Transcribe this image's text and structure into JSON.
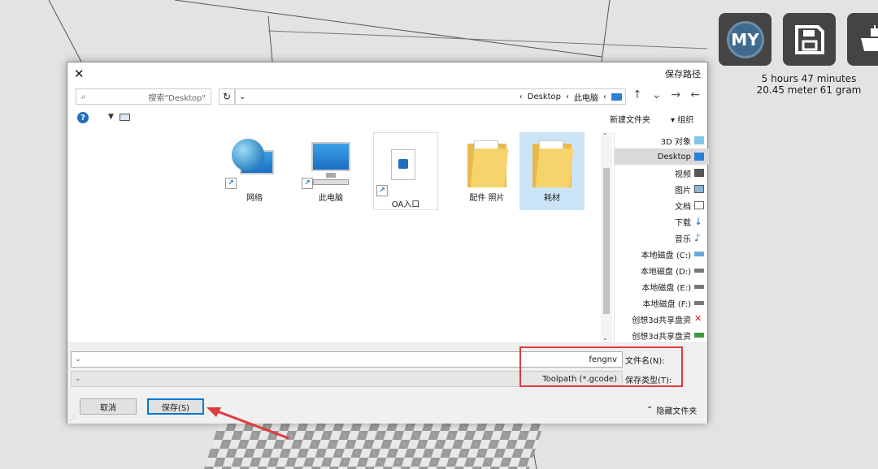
{
  "scene": {
    "buttons": [
      {
        "name": "my-icon",
        "label": "MY"
      },
      {
        "name": "save-icon"
      },
      {
        "name": "ship-icon"
      }
    ],
    "print_time": "5 hours 47 minutes",
    "print_material": "20.45 meter 61 gram"
  },
  "dialog": {
    "title": "保存路径",
    "close_glyph": "✕",
    "search_placeholder": "搜索\"Desktop\"",
    "refresh_glyph": "↻",
    "breadcrumbs": [
      "Desktop",
      "此电脑"
    ],
    "toolbar": {
      "organize": "组织",
      "new_folder": "新建文件夹"
    },
    "nav_items": [
      {
        "label": "3D 对象"
      },
      {
        "label": "Desktop",
        "selected": true
      },
      {
        "label": "视频"
      },
      {
        "label": "图片"
      },
      {
        "label": "文档"
      },
      {
        "label": "下载"
      },
      {
        "label": "音乐"
      },
      {
        "label": "本地磁盘 (C:)"
      },
      {
        "label": "本地磁盘 (D:)"
      },
      {
        "label": "本地磁盘 (E:)"
      },
      {
        "label": "本地磁盘 (F:)"
      },
      {
        "label": "创想3d共享盘资"
      },
      {
        "label": "创想3d共享盘资"
      }
    ],
    "files": [
      {
        "label": "耗材",
        "kind": "folder",
        "selected": true
      },
      {
        "label": "配件 照片",
        "kind": "folder"
      },
      {
        "label": "OA入口",
        "kind": "shortcut-doc"
      },
      {
        "label": "此电脑",
        "kind": "computer"
      },
      {
        "label": "网络",
        "kind": "network"
      }
    ],
    "filename_label": "文件名(N):",
    "filename_value": "fengnv",
    "filetype_label": "保存类型(T):",
    "filetype_value": "Toolpath (*.gcode)",
    "hide_folders": "隐藏文件夹",
    "save_button": "保存(S)",
    "cancel_button": "取消"
  },
  "colors": {
    "highlight": "#e03a3a",
    "accent": "#0078d7"
  }
}
